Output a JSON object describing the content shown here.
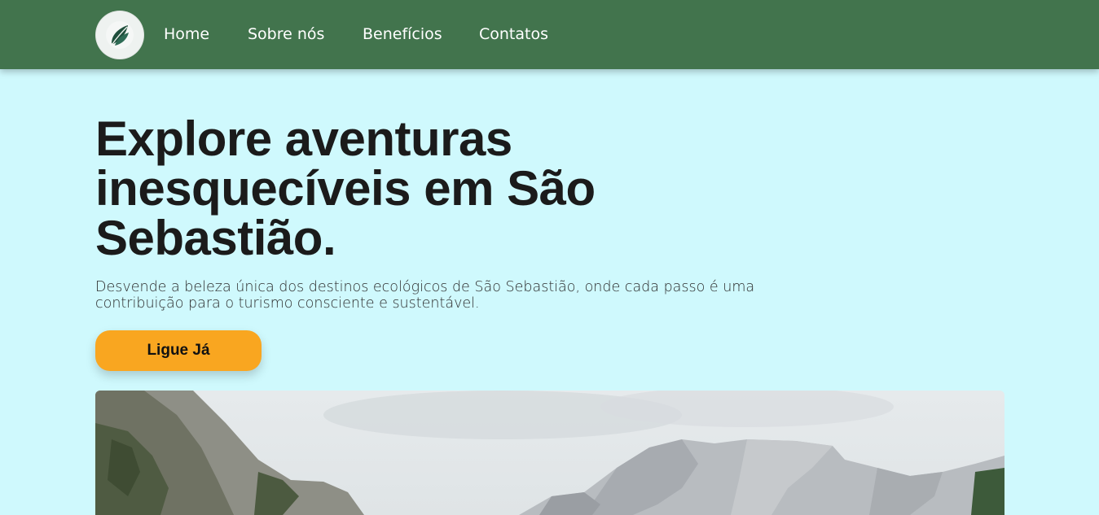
{
  "navbar": {
    "logo_icon": "leaf-logo-icon",
    "links": [
      "Home",
      "Sobre nós",
      "Benefícios",
      "Contatos"
    ],
    "bg_color": "#42744d"
  },
  "hero": {
    "title": "Explore aventuras inesquecíveis em São Sebastião.",
    "description": "Desvende a beleza única dos destinos ecológicos de São Sebastião, onde cada passo é uma contribuição para o turismo consciente e sustentável.",
    "cta_label": "Ligue Já",
    "cta_color": "#f9a620",
    "image": "mountain-landscape-photo"
  },
  "colors": {
    "background": "#cff9fd",
    "text": "#1b1b1b"
  }
}
